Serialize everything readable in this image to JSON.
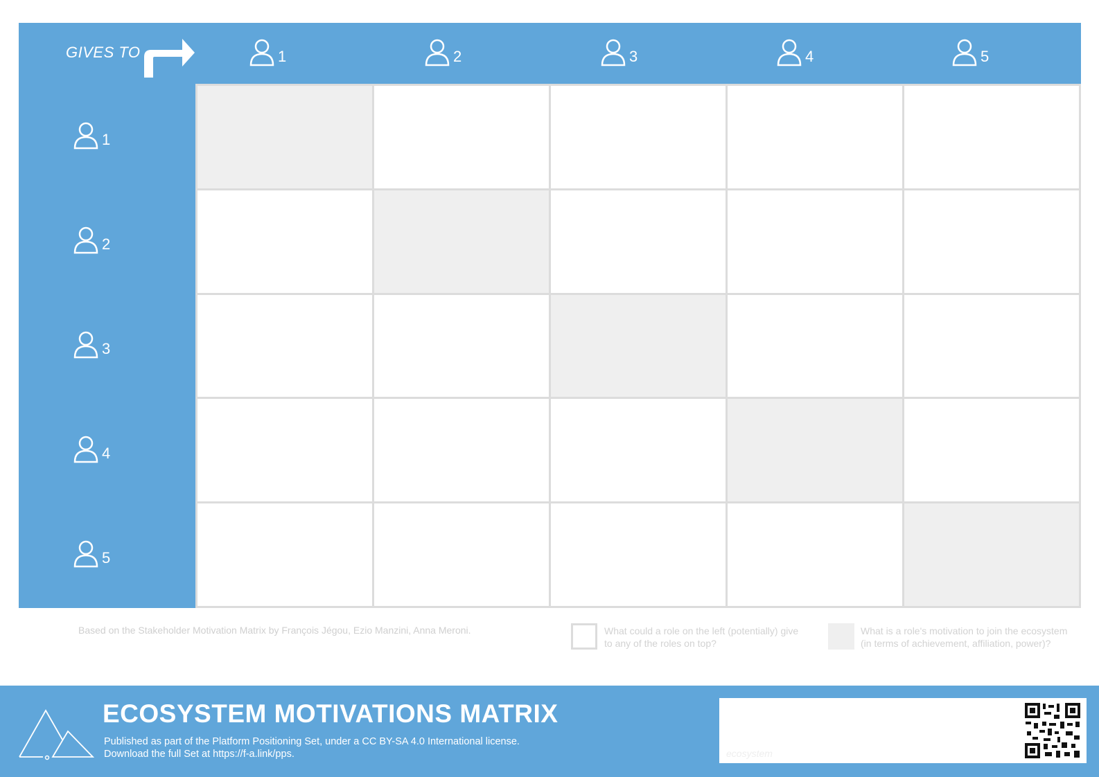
{
  "header": {
    "gives_to": "GIVES TO"
  },
  "columns": [
    {
      "label": "1"
    },
    {
      "label": "2"
    },
    {
      "label": "3"
    },
    {
      "label": "4"
    },
    {
      "label": "5"
    }
  ],
  "rows": [
    {
      "label": "1"
    },
    {
      "label": "2"
    },
    {
      "label": "3"
    },
    {
      "label": "4"
    },
    {
      "label": "5"
    }
  ],
  "credit": "Based on the Stakeholder Motivation Matrix by François Jégou, Ezio Manzini, Anna Meroni.",
  "legend": {
    "white_line1": "What could a role on the left (potentially) give",
    "white_line2": "to any of the roles on top?",
    "grey_line1": "What is a role's motivation to join the ecosystem",
    "grey_line2": "(in terms of achievement, affiliation, power)?"
  },
  "footer": {
    "title": "ECOSYSTEM MOTIVATIONS MATRIX",
    "line1": "Published as part of the Platform Positioning Set, under a CC BY-SA 4.0 International license.",
    "line2": "Download the full Set at https://f-a.link/pps.",
    "panel_word": "ecosystem"
  },
  "colors": {
    "brand_blue": "#60a6da",
    "diagonal_grey": "#efefef",
    "grid_line": "#dcdcdc"
  }
}
